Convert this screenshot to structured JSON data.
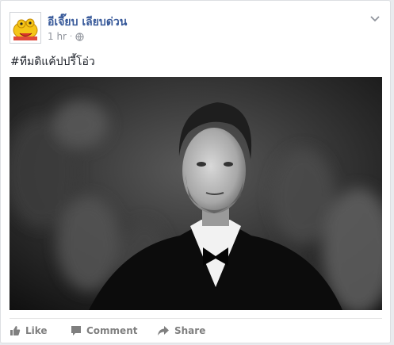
{
  "post": {
    "author": "อีเจี๊ยบ เลียบด่วน",
    "time": "1 hr",
    "separator": "·",
    "text": "#ทีมดิแค้ปปรี้โอ่ว"
  },
  "actions": {
    "like": "Like",
    "comment": "Comment",
    "share": "Share"
  },
  "colors": {
    "link": "#365899",
    "meta": "#90949c",
    "action": "#7f7f7f"
  },
  "icons": {
    "avatar": "yellow-cartoon-avatar",
    "privacy": "globe-icon",
    "menu": "chevron-down-icon",
    "like": "thumbs-up-icon",
    "comment": "comment-bubble-icon",
    "share": "share-arrow-icon"
  }
}
